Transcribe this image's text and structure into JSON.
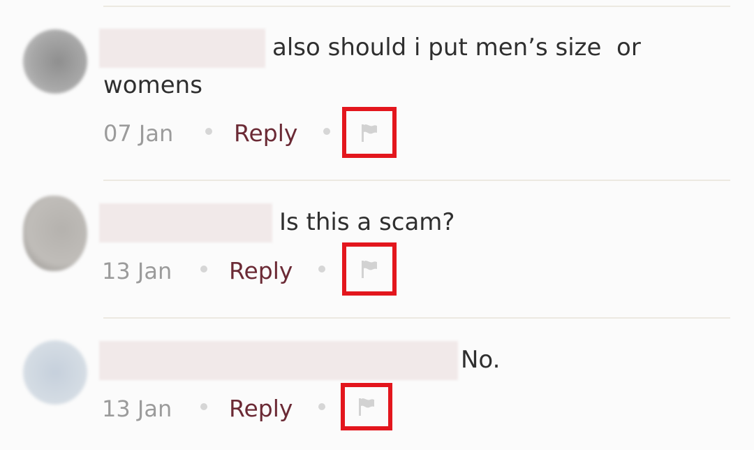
{
  "colors": {
    "text": "#2f2f2f",
    "date": "#9b9b9b",
    "reply": "#6b2a35",
    "highlight": "#e3161d",
    "icon": "#d2d2d2"
  },
  "comments": [
    {
      "text_line1": "also should i put men’s size  or",
      "text_line2": "womens",
      "date": "07 Jan",
      "reply_label": "Reply",
      "flag_icon": "flag-icon"
    },
    {
      "text_line1": "Is this a scam?",
      "date": "13 Jan",
      "reply_label": "Reply",
      "flag_icon": "flag-icon"
    },
    {
      "text_line1": "No.",
      "date": "13 Jan",
      "reply_label": "Reply",
      "flag_icon": "flag-icon"
    }
  ]
}
